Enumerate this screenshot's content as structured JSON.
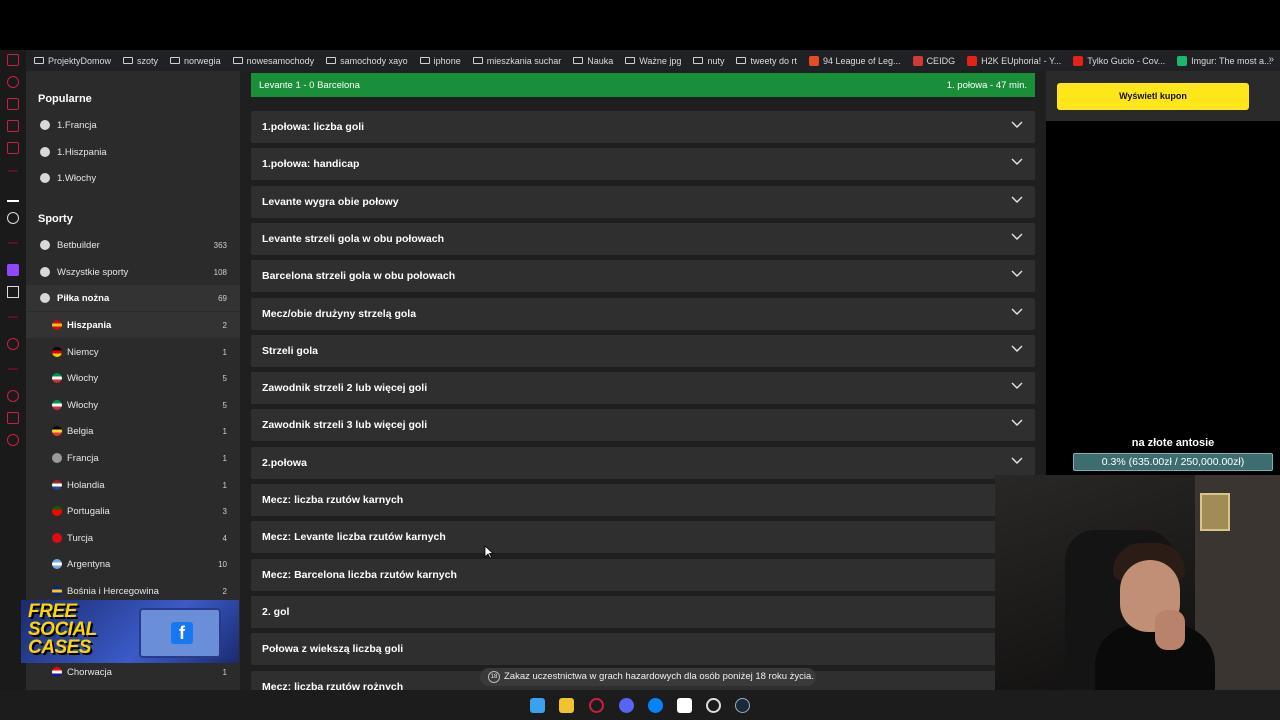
{
  "bookmarks": [
    {
      "label": "ProjektyDomow",
      "kind": "folder"
    },
    {
      "label": "szoty",
      "kind": "folder"
    },
    {
      "label": "norwegia",
      "kind": "folder"
    },
    {
      "label": "nowesamochody",
      "kind": "folder"
    },
    {
      "label": "samochody xayo",
      "kind": "folder"
    },
    {
      "label": "iphone",
      "kind": "folder"
    },
    {
      "label": "mieszkania suchar",
      "kind": "folder"
    },
    {
      "label": "Nauka",
      "kind": "folder"
    },
    {
      "label": "Ważne jpg",
      "kind": "folder"
    },
    {
      "label": "nuty",
      "kind": "folder"
    },
    {
      "label": "tweety do rt",
      "kind": "folder"
    },
    {
      "label": "94 League of Leg...",
      "kind": "site",
      "color": "#e44b26"
    },
    {
      "label": "CEIDG",
      "kind": "site",
      "color": "#d23a3a"
    },
    {
      "label": "H2K EUphoria! - Y...",
      "kind": "site",
      "color": "#e62117"
    },
    {
      "label": "Tylko Gucio - Cov...",
      "kind": "site",
      "color": "#e62117"
    },
    {
      "label": "Imgur: The most a...",
      "kind": "site",
      "color": "#1bb76e"
    }
  ],
  "sidebar": {
    "popular_heading": "Popularne",
    "popular": [
      {
        "label": "1.Francja"
      },
      {
        "label": "1.Hiszpania"
      },
      {
        "label": "1.Włochy"
      }
    ],
    "sports_heading": "Sporty",
    "sports": [
      {
        "label": "Betbuilder",
        "count": "363"
      },
      {
        "label": "Wszystkie sporty",
        "count": "108"
      },
      {
        "label": "Piłka nożna",
        "count": "69"
      }
    ],
    "countries": [
      {
        "label": "Hiszpania",
        "count": "2",
        "flag": [
          "#c60b1e",
          "#ffc400",
          "#c60b1e"
        ]
      },
      {
        "label": "Niemcy",
        "count": "1",
        "flag": [
          "#000000",
          "#dd0000",
          "#ffce00"
        ]
      },
      {
        "label": "Włochy",
        "count": "5",
        "flag": [
          "#009246",
          "#ffffff",
          "#ce2b37"
        ]
      },
      {
        "label": "Włochy",
        "count": "5",
        "flag": [
          "#009246",
          "#ffffff",
          "#ce2b37"
        ]
      },
      {
        "label": "Belgia",
        "count": "1",
        "flag": [
          "#000000",
          "#fdda24",
          "#ef3340"
        ]
      },
      {
        "label": "Francja",
        "count": "1",
        "flag": [
          "#9a9a9a",
          "#9a9a9a",
          "#9a9a9a"
        ]
      },
      {
        "label": "Holandia",
        "count": "1",
        "flag": [
          "#ae1c28",
          "#ffffff",
          "#21468b"
        ]
      },
      {
        "label": "Portugalia",
        "count": "3",
        "flag": [
          "#006600",
          "#ff0000",
          "#ff0000"
        ]
      },
      {
        "label": "Turcja",
        "count": "4",
        "flag": [
          "#e30a17",
          "#e30a17",
          "#e30a17"
        ]
      },
      {
        "label": "Argentyna",
        "count": "10",
        "flag": [
          "#74acdf",
          "#ffffff",
          "#74acdf"
        ]
      },
      {
        "label": "Bośnia i Hercegowina",
        "count": "2",
        "flag": [
          "#002395",
          "#fecb00",
          "#002395"
        ]
      },
      {
        "label": "Chorwacja",
        "count": "1",
        "flag": [
          "#ff0000",
          "#ffffff",
          "#171796"
        ]
      }
    ]
  },
  "ad": {
    "line1": "FREE",
    "line2": "SOCIAL",
    "line3": "CASES",
    "fb": "f"
  },
  "match": {
    "teams_score": "Levante   1 - 0   Barcelona",
    "status": "1. połowa - 47 min."
  },
  "markets": [
    "1.połowa: liczba goli",
    "1.połowa: handicap",
    "Levante wygra obie połowy",
    "Levante strzeli gola w obu połowach",
    "Barcelona strzeli gola w obu połowach",
    "Mecz/obie drużyny strzelą gola",
    "Strzeli gola",
    "Zawodnik strzeli 2 lub więcej goli",
    "Zawodnik strzeli 3 lub więcej goli",
    "2.połowa",
    "Mecz: liczba rzutów karnych",
    "Mecz: Levante liczba rzutów karnych",
    "Mecz: Barcelona liczba rzutów karnych",
    "2. gol",
    "Połowa z wiekszą liczbą goli",
    "Mecz: liczba rzutów rożnych"
  ],
  "coupon": {
    "label": "Wyświetl kupon"
  },
  "goal": {
    "title": "na złote antosie",
    "progress": "0.3% (635.00zł / 250,000.00zł)",
    "fraction": 0.003
  },
  "notice": {
    "badge": "18",
    "text": "Zakaz uczestnictwa w grach hazardowych dla osób poniżej 18 roku życia."
  },
  "colors": {
    "accent": "#ffe61a",
    "score_green": "#1a8f3a",
    "brand_red": "#c9203f"
  }
}
